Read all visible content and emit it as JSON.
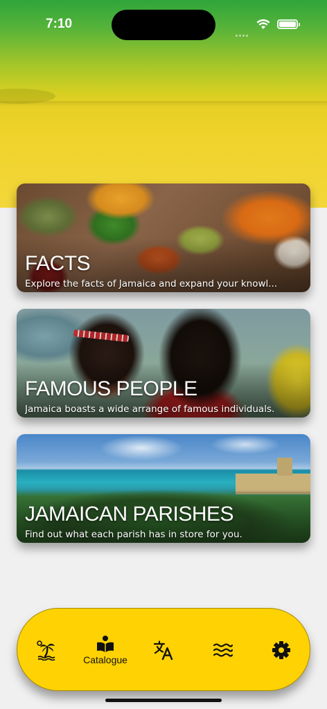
{
  "status_bar": {
    "time": "7:10"
  },
  "cards": [
    {
      "title": "FACTS",
      "subtitle": "Explore the facts of Jamaica and expand your knowl..."
    },
    {
      "title": "FAMOUS PEOPLE",
      "subtitle": "Jamaica boasts a wide arrange of famous individuals."
    },
    {
      "title": "JAMAICAN PARISHES",
      "subtitle": "Find out what each parish has in store for you."
    }
  ],
  "tab_bar": {
    "tabs": [
      {
        "icon": "palm-tree-icon",
        "label": ""
      },
      {
        "icon": "open-book-icon",
        "label": "Catalogue",
        "selected": true
      },
      {
        "icon": "translate-icon",
        "label": ""
      },
      {
        "icon": "waves-icon",
        "label": ""
      },
      {
        "icon": "gear-icon",
        "label": ""
      }
    ],
    "background_color": "#ffd204"
  },
  "colors": {
    "header_green": "#2fa53a",
    "header_yellow": "#f0d32b",
    "page_background": "#f0f0f0"
  }
}
